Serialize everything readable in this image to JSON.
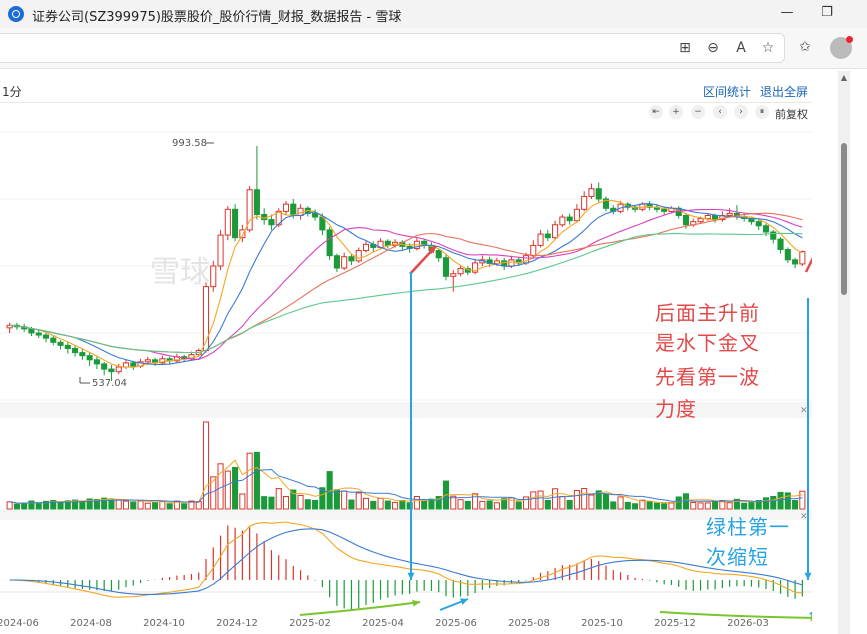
{
  "window": {
    "title": "证券公司(SZ399975)股票股价_股价行情_财报_数据报告 - 雪球",
    "minimize_glyph": "—",
    "maximize_glyph": "❐"
  },
  "toolbar": {
    "icons": [
      "apps-icon",
      "zoom-out-icon",
      "read-aloud-icon",
      "favorite-icon",
      "favorites-list-icon",
      "profile-avatar"
    ],
    "glyphs": {
      "apps": "⊞",
      "zoom": "⊖",
      "read": "A",
      "star": "☆",
      "favs": "✩"
    }
  },
  "chart_header": {
    "period": "1分",
    "interval_stats": "区间统计",
    "exit_fullscreen": "退出全屏",
    "adjust": "前复权",
    "controls": [
      "⇤",
      "+",
      "−",
      "‹",
      "›",
      "⏸"
    ]
  },
  "watermark": "雪球",
  "annotations": {
    "red_text": [
      "后面主升前",
      "是水下金叉",
      "先看第一波",
      "力度"
    ],
    "blue_text": [
      "绿柱第一",
      "次缩短"
    ]
  },
  "colors": {
    "up": "#d9342b",
    "down": "#1b9a3a",
    "ma5": "#f5a623",
    "ma10": "#3a7bd5",
    "ma20": "#d93fbe",
    "ma30": "#e8735a",
    "ma60": "#5cc98a",
    "arrow_red": "#e24a4a",
    "arrow_blue": "#29a3e3",
    "arrow_green": "#7ac52e"
  },
  "chart_data": {
    "type": "candlestick",
    "x_ticks": [
      "2024-06",
      "2024-08",
      "2024-10",
      "2024-12",
      "2025-02",
      "2025-04",
      "2025-06",
      "2025-08",
      "2025-10",
      "2025-12",
      "2026-03"
    ],
    "price_labels": {
      "high": "993.58",
      "low": "537.04"
    },
    "price_range": [
      500,
      1020
    ],
    "candles": [
      [
        640,
        645,
        630,
        650
      ],
      [
        645,
        642,
        636,
        650
      ],
      [
        642,
        638,
        632,
        648
      ],
      [
        638,
        630,
        624,
        642
      ],
      [
        630,
        626,
        620,
        636
      ],
      [
        626,
        620,
        612,
        632
      ],
      [
        620,
        612,
        606,
        626
      ],
      [
        612,
        606,
        598,
        616
      ],
      [
        606,
        600,
        590,
        612
      ],
      [
        600,
        592,
        584,
        606
      ],
      [
        592,
        586,
        578,
        598
      ],
      [
        586,
        578,
        566,
        592
      ],
      [
        578,
        570,
        560,
        584
      ],
      [
        570,
        560,
        548,
        574
      ],
      [
        560,
        555,
        537,
        568
      ],
      [
        555,
        564,
        550,
        570
      ],
      [
        564,
        572,
        560,
        578
      ],
      [
        572,
        566,
        558,
        576
      ],
      [
        566,
        574,
        562,
        580
      ],
      [
        574,
        578,
        568,
        584
      ],
      [
        578,
        572,
        566,
        582
      ],
      [
        572,
        580,
        568,
        586
      ],
      [
        580,
        576,
        570,
        584
      ],
      [
        576,
        584,
        572,
        590
      ],
      [
        584,
        580,
        574,
        588
      ],
      [
        580,
        588,
        576,
        594
      ],
      [
        588,
        596,
        584,
        600
      ],
      [
        596,
        720,
        592,
        728
      ],
      [
        720,
        760,
        710,
        770
      ],
      [
        760,
        820,
        752,
        830
      ],
      [
        820,
        870,
        810,
        876
      ],
      [
        870,
        815,
        808,
        880
      ],
      [
        815,
        830,
        806,
        840
      ],
      [
        830,
        908,
        825,
        915
      ],
      [
        908,
        860,
        850,
        993
      ],
      [
        860,
        850,
        840,
        872
      ],
      [
        850,
        840,
        830,
        860
      ],
      [
        840,
        866,
        835,
        872
      ],
      [
        866,
        880,
        860,
        886
      ],
      [
        880,
        858,
        852,
        890
      ],
      [
        858,
        872,
        850,
        880
      ],
      [
        872,
        862,
        856,
        876
      ],
      [
        862,
        855,
        848,
        870
      ],
      [
        855,
        830,
        820,
        862
      ],
      [
        830,
        780,
        772,
        836
      ],
      [
        780,
        756,
        748,
        784
      ],
      [
        756,
        778,
        752,
        786
      ],
      [
        778,
        770,
        762,
        784
      ],
      [
        770,
        790,
        766,
        796
      ],
      [
        790,
        802,
        786,
        808
      ],
      [
        802,
        796,
        788,
        808
      ],
      [
        796,
        808,
        792,
        814
      ],
      [
        808,
        800,
        794,
        812
      ],
      [
        800,
        806,
        796,
        812
      ],
      [
        806,
        798,
        790,
        810
      ],
      [
        798,
        794,
        786,
        804
      ],
      [
        794,
        808,
        790,
        816
      ],
      [
        808,
        800,
        794,
        812
      ],
      [
        800,
        790,
        784,
        806
      ],
      [
        790,
        776,
        768,
        794
      ],
      [
        776,
        740,
        732,
        782
      ],
      [
        740,
        745,
        710,
        752
      ],
      [
        745,
        755,
        740,
        760
      ],
      [
        755,
        748,
        742,
        760
      ],
      [
        748,
        766,
        744,
        774
      ],
      [
        766,
        772,
        760,
        780
      ],
      [
        772,
        765,
        758,
        778
      ],
      [
        765,
        770,
        760,
        776
      ],
      [
        770,
        760,
        752,
        776
      ],
      [
        760,
        772,
        756,
        780
      ],
      [
        772,
        766,
        760,
        778
      ],
      [
        766,
        780,
        762,
        786
      ],
      [
        780,
        800,
        776,
        810
      ],
      [
        800,
        822,
        796,
        830
      ],
      [
        822,
        815,
        808,
        830
      ],
      [
        815,
        840,
        810,
        848
      ],
      [
        840,
        855,
        836,
        860
      ],
      [
        855,
        848,
        840,
        862
      ],
      [
        848,
        870,
        844,
        880
      ],
      [
        870,
        895,
        866,
        905
      ],
      [
        895,
        910,
        890,
        920
      ],
      [
        910,
        890,
        884,
        922
      ],
      [
        890,
        872,
        866,
        895
      ],
      [
        872,
        866,
        860,
        878
      ],
      [
        866,
        880,
        862,
        886
      ],
      [
        880,
        874,
        868,
        884
      ],
      [
        874,
        870,
        864,
        878
      ],
      [
        870,
        880,
        866,
        884
      ],
      [
        880,
        874,
        868,
        886
      ],
      [
        874,
        870,
        864,
        880
      ],
      [
        870,
        866,
        860,
        874
      ],
      [
        866,
        872,
        862,
        876
      ],
      [
        872,
        858,
        852,
        876
      ],
      [
        858,
        840,
        832,
        862
      ],
      [
        840,
        846,
        836,
        852
      ],
      [
        846,
        852,
        842,
        856
      ],
      [
        852,
        858,
        848,
        862
      ],
      [
        858,
        850,
        844,
        862
      ],
      [
        850,
        858,
        846,
        866
      ],
      [
        858,
        862,
        854,
        872
      ],
      [
        862,
        856,
        850,
        878
      ],
      [
        856,
        852,
        846,
        862
      ],
      [
        852,
        846,
        840,
        856
      ],
      [
        846,
        838,
        830,
        850
      ],
      [
        838,
        826,
        818,
        842
      ],
      [
        826,
        812,
        804,
        830
      ],
      [
        812,
        792,
        784,
        816
      ],
      [
        792,
        772,
        766,
        796
      ],
      [
        772,
        764,
        756,
        776
      ],
      [
        764,
        788,
        760,
        790
      ]
    ],
    "macd_hist_span": [
      -60,
      60
    ],
    "legend": []
  }
}
